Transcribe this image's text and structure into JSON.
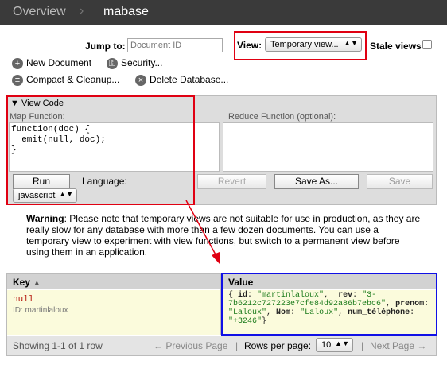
{
  "breadcrumb": {
    "overview": "Overview",
    "database": "mabase"
  },
  "jump": {
    "label": "Jump to:",
    "placeholder": "Document ID"
  },
  "view": {
    "label": "View:",
    "selected": "Temporary view...",
    "stale_label": "Stale views"
  },
  "actions": {
    "new_document": "New Document",
    "security": "Security...",
    "compact": "Compact & Cleanup...",
    "delete": "Delete Database..."
  },
  "code_panel": {
    "title": "View Code",
    "map_label": "Map Function:",
    "reduce_label": "Reduce Function (optional):",
    "map_code": "function(doc) {\n  emit(null, doc);\n}",
    "run": "Run",
    "language_label": "Language:",
    "language": "javascript",
    "revert": "Revert",
    "save_as": "Save As...",
    "save": "Save"
  },
  "warning": {
    "bold": "Warning",
    "text": ": Please note that temporary views are not suitable for use in production, as they are really slow for any database with more than a few dozen documents. You can use a temporary view to experiment with view functions, but switch to a permanent view before using them in an application."
  },
  "results": {
    "key_header": "Key",
    "value_header": "Value",
    "row": {
      "key": "null",
      "id_label": "ID: martinlaloux",
      "value": {
        "k1": "_id",
        "v1": "\"martinlaloux\"",
        "k2": "_rev",
        "v2": "\"3-7b6212c727223e7cfe84d92a86b7ebc6\"",
        "k3": "prenom",
        "v3": "\"Laloux\"",
        "k4": "Nom",
        "v4": "\"Laloux\"",
        "k5": "num_téléphone",
        "v5": "\"+3246\""
      }
    },
    "showing": "Showing 1-1 of 1 row",
    "prev": "← Previous Page",
    "rows_label": "Rows per page:",
    "rows_value": "10",
    "next": "Next Page →"
  },
  "colors": {
    "highlight_red": "#e00012",
    "highlight_blue": "#1010e6"
  }
}
